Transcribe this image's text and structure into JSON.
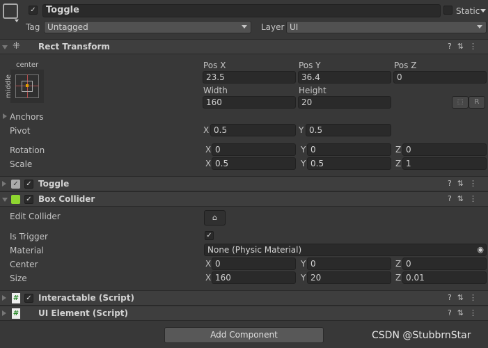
{
  "header": {
    "name": "Toggle",
    "active": true,
    "static_label": "Static",
    "tag_label": "Tag",
    "tag_value": "Untagged",
    "layer_label": "Layer",
    "layer_value": "UI"
  },
  "rect_transform": {
    "title": "Rect Transform",
    "anchor_h": "center",
    "anchor_v": "middle",
    "pos_x_label": "Pos X",
    "pos_y_label": "Pos Y",
    "pos_z_label": "Pos Z",
    "pos_x": "23.5",
    "pos_y": "36.4",
    "pos_z": "0",
    "width_label": "Width",
    "height_label": "Height",
    "width": "160",
    "height": "20",
    "r_button": "R",
    "anchors_label": "Anchors",
    "pivot_label": "Pivot",
    "pivot_x": "0.5",
    "pivot_y": "0.5",
    "rotation_label": "Rotation",
    "rot_x": "0",
    "rot_y": "0",
    "rot_z": "0",
    "scale_label": "Scale",
    "scale_x": "0.5",
    "scale_y": "0.5",
    "scale_z": "1"
  },
  "axis": {
    "x": "X",
    "y": "Y",
    "z": "Z"
  },
  "toggle": {
    "title": "Toggle"
  },
  "box_collider": {
    "title": "Box Collider",
    "edit_collider_label": "Edit Collider",
    "is_trigger_label": "Is Trigger",
    "is_trigger": true,
    "material_label": "Material",
    "material_value": "None (Physic Material)",
    "center_label": "Center",
    "center_x": "0",
    "center_y": "0",
    "center_z": "0",
    "size_label": "Size",
    "size_x": "160",
    "size_y": "20",
    "size_z": "0.01"
  },
  "interactable": {
    "title": "Interactable (Script)"
  },
  "ui_element": {
    "title": "UI Element (Script)"
  },
  "add_component": "Add Component",
  "watermark": "CSDN @StubbrnStar"
}
